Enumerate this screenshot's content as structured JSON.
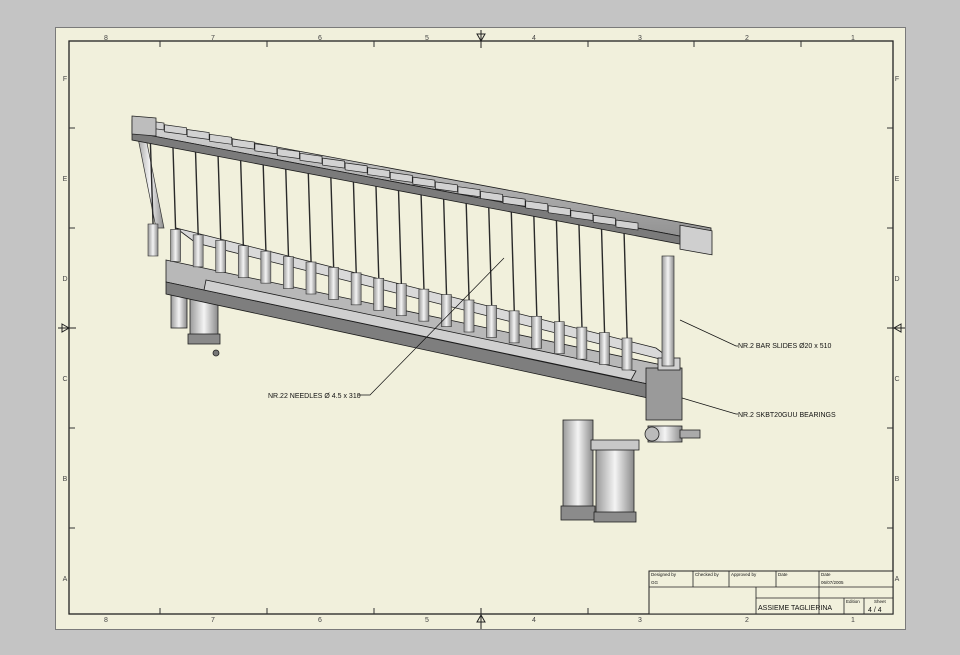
{
  "frame": {
    "columns": [
      "8",
      "7",
      "6",
      "5",
      "4",
      "3",
      "2",
      "1"
    ],
    "rows": [
      "F",
      "E",
      "D",
      "C",
      "B",
      "A"
    ]
  },
  "callouts": {
    "bar_slides": "NR.2 BAR SLIDES Ø20 x 510",
    "bearings": "NR.2 SKBT20GUU BEARINGS",
    "needles": "NR.22 NEEDLES Ø 4.5 x 310"
  },
  "title_block": {
    "designed_by_label": "Designed by",
    "designed_by_value": "GG",
    "checked_by_label": "Checked by",
    "approved_by_label": "Approved by",
    "date_label": "Date",
    "date2_label": "Date",
    "date2_value": "06/07/2005",
    "title": "ASSIEME TAGLIERINA",
    "edition_label": "Edition",
    "sheet_label": "Sheet",
    "sheet_value": "4 / 4"
  }
}
